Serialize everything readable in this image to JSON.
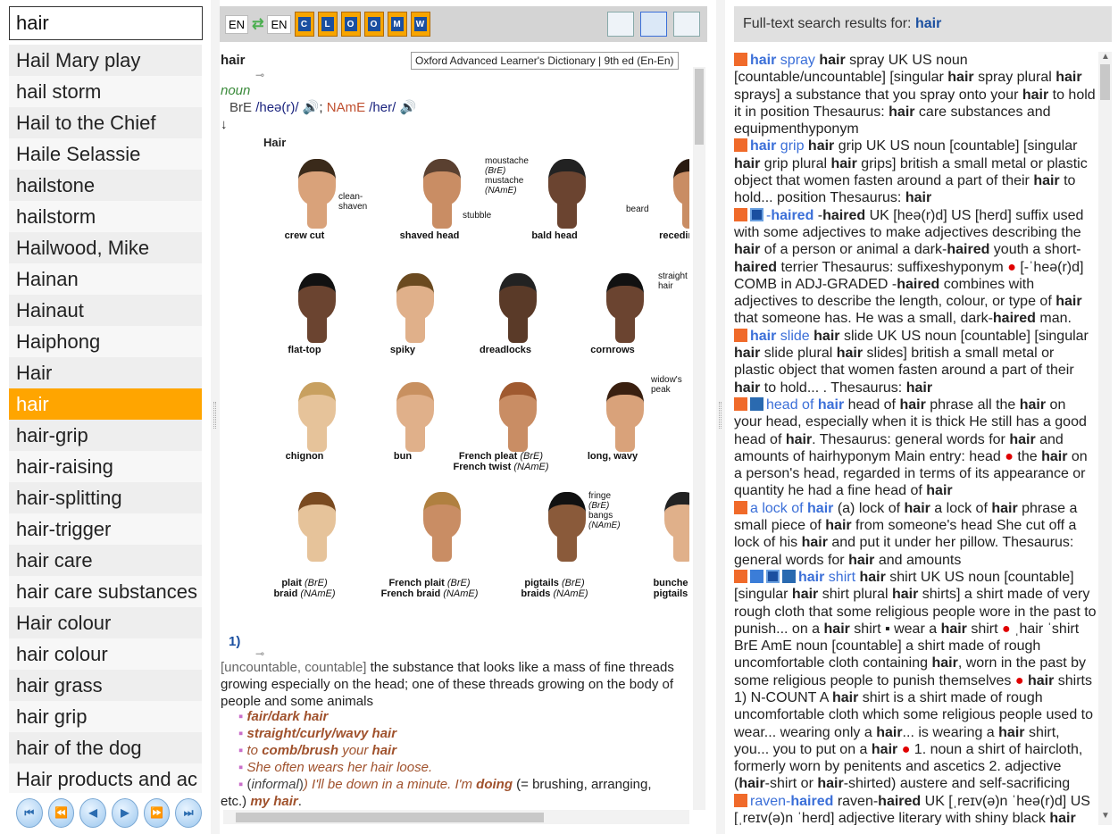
{
  "search": {
    "value": "hair"
  },
  "wordlist": {
    "items": [
      "Hail Mary play",
      "hail storm",
      "Hail to the Chief",
      "Haile Selassie",
      "hailstone",
      "hailstorm",
      "Hailwood, Mike",
      "Hainan",
      "Hainaut",
      "Haiphong",
      "Hair",
      "hair",
      "hair-grip",
      "hair-raising",
      "hair-splitting",
      "hair-trigger",
      "hair care",
      "hair care substances",
      "Hair colour",
      "hair colour",
      "hair grass",
      "hair grip",
      "hair of the dog",
      "Hair products and ac"
    ],
    "selected_index": 11
  },
  "nav": {
    "first": "⏮",
    "prev_page": "⏪",
    "prev": "◀",
    "next": "▶",
    "next_page": "⏩",
    "last": "⏭"
  },
  "toolbar": {
    "src_lang": "EN",
    "tgt_lang": "EN",
    "swap_icon": "⇄",
    "dict_icons": [
      "C",
      "L",
      "O",
      "O",
      "M",
      "W"
    ]
  },
  "article": {
    "headword": "hair",
    "source": "Oxford Advanced Learner's Dictionary | 9th ed (En-En)",
    "key_icon": "⊸",
    "pos": "noun",
    "pron_bre_label": "BrE",
    "pron_bre": "/heə(r)/",
    "speaker": "🔊",
    "sep": ";",
    "pron_name_label": "NAmE",
    "pron_name": "/her/",
    "arrow": "↓",
    "figure": {
      "title": "Hair",
      "captions": [
        "crew cut",
        "shaved head",
        "bald head",
        "receding",
        "flat-top",
        "spiky",
        "dreadlocks",
        "cornrows",
        "chignon",
        "bun",
        "long, wavy",
        "pigtails",
        "braids"
      ],
      "french_pleat": "French pleat",
      "french_twist": "French twist",
      "plait": "plait",
      "braid": "braid",
      "french_plait": "French plait",
      "french_braid": "French braid",
      "bunches": "bunche",
      "pigtails2": "pigtails",
      "bre": "(BrE)",
      "name": "(NAmE)",
      "notes": {
        "clean": "clean-",
        "shaven": "shaven",
        "stubble": "stubble",
        "moustache1": "moustache",
        "moustache2": "mustache",
        "beard": "beard",
        "straight": "straight",
        "hair": "hair",
        "widows": "widow's",
        "peak": "peak",
        "fringe": "fringe",
        "bangs": "bangs"
      }
    },
    "sense_num": "1)",
    "gram": "[uncountable, countable]",
    "definition": " the substance that looks like a mass of fine threads growing especially on the head; one of these threads growing on the body of people and some animals",
    "examples": {
      "e1": "fair/dark hair",
      "e2": "straight/curly/wavy hair",
      "e3a": "to ",
      "e3b": "comb/brush",
      "e3c": " your ",
      "e3d": "hair",
      "e4": "She often wears her hair loose.",
      "e5a": "(",
      "e5b": "informal",
      "e5c": ") I'll be down in a minute. I'm ",
      "e5d": "doing",
      "e5e": " (= brushing, arranging,",
      "e6a": "etc.) ",
      "e6b": "my hair",
      "e6c": "."
    }
  },
  "results": {
    "header_prefix": "Full-text search results for: ",
    "query": "hair",
    "items": [
      {
        "icons": [
          "ox"
        ],
        "html": "<span class='rlink'><b>hair</b> spray</span> <b>hair</b> spray UK US noun [countable/uncountable] [singular <b>hair</b> spray plural <b>hair</b> sprays] a substance that you spray onto your <b>hair</b> to hold it in position Thesaurus: <b>hair</b> care substances and equipmenthyponym"
      },
      {
        "icons": [
          "ox"
        ],
        "html": "<span class='rlink'><b>hair</b> grip</span> <b>hair</b> grip UK US noun [countable] [singular <b>hair</b> grip plural <b>hair</b> grips] british a small metal or plastic object that women fasten around a part of their <b>hair</b> to hold... position Thesaurus: <b>hair</b>"
      },
      {
        "icons": [
          "ox",
          "co"
        ],
        "html": "<span class='rlink'>-<b>haired</b></span> -<b>haired</b> UK [heə(r)d] US [herd] suffix used with some adjectives to make adjectives describing the <b>hair</b> of a person or animal a dark-<b>haired</b> youth a short-<b>haired</b> terrier Thesaurus: suffixeshyponym <span class='dot'>●</span> [-ˈheə(r)d] COMB in ADJ-GRADED -<b>haired</b> combines with adjectives to describe the length, colour, or type of <b>hair</b> that someone has. He was a small, dark-<b>haired</b> man."
      },
      {
        "icons": [
          "ox"
        ],
        "html": "<span class='rlink'><b>hair</b> slide</span> <b>hair</b> slide UK US noun [countable] [singular <b>hair</b> slide plural <b>hair</b> slides] british a small metal or plastic object that women fasten around a part of their <b>hair</b> to hold... . Thesaurus: <b>hair</b>"
      },
      {
        "icons": [
          "ox",
          "ot"
        ],
        "html": "<span class='rlink'>head of <b>hair</b></span> head of <b>hair</b> phrase all the <b>hair</b> on your head, especially when it is thick He still has a good head of <b>hair</b>. Thesaurus: general words for <b>hair</b> and amounts of hairhyponym Main entry: head <span class='dot'>●</span> the <b>hair</b> on a person's head, regarded in terms of its appearance or quantity he had a fine head of <b>hair</b>"
      },
      {
        "icons": [
          "ox"
        ],
        "html": "<span class='rlink'>a lock of <b>hair</b></span> (a) lock of <b>hair</b> a lock of <b>hair</b> phrase a small piece of <b>hair</b> from someone's head She cut off a lock of his <b>hair</b> and put it under her pillow. Thesaurus: general words for <b>hair</b> and amounts"
      },
      {
        "icons": [
          "ox",
          "wi",
          "co",
          "ot"
        ],
        "html": "<span class='rlink'><b>hair</b> shirt</span> <b>hair</b> shirt UK US noun [countable] [singular <b>hair</b> shirt plural <b>hair</b> shirts] a shirt made of very rough cloth that some religious people wore in the past to punish... on a <b>hair</b> shirt ▪ wear a <b>hair</b> shirt <span class='dot'>●</span> ˌhair ˈshirt BrE AmE noun [countable] a shirt made of rough uncomfortable cloth containing <b>hair</b>, worn in the past by some religious people to punish themselves <span class='dot'>●</span> <b>hair</b> shirts 1) N-COUNT A <b>hair</b> shirt is a shirt made of rough uncomfortable cloth which some religious people used to wear... wearing only a <b>hair</b>... is wearing a <b>hair</b> shirt, you... you to put on a <b>hair</b> <span class='dot'>●</span> 1. noun a shirt of haircloth, formerly worn by penitents and ascetics 2. adjective (<b>hair</b>-shirt or <b>hair</b>-shirted) austere and self-sacrificing"
      },
      {
        "icons": [
          "ox"
        ],
        "html": "<span class='rlink'>raven-<b>haired</b></span> raven-<b>haired</b> UK [ˌreɪv(ə)n ˈheə(r)d] US [ˌreɪv(ə)n ˈherd] adjective literary with shiny black <b>hair</b>"
      }
    ]
  }
}
